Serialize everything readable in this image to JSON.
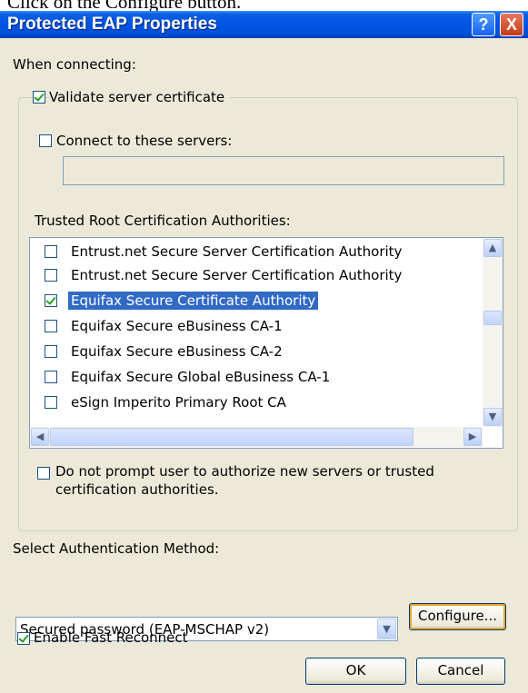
{
  "caption": "Click on the Configure button.",
  "window": {
    "title": "Protected EAP Properties",
    "help_glyph": "?",
    "close_glyph": "X"
  },
  "when_connecting": "When connecting:",
  "validate_cert": {
    "label": "Validate server certificate",
    "checked": true
  },
  "connect_servers": {
    "label": "Connect to these servers:",
    "checked": false,
    "value": ""
  },
  "trusted_roots": {
    "label": "Trusted Root Certification Authorities:",
    "items": [
      {
        "label": "Entrust.net Secure Server Certification Authority",
        "checked": false,
        "selected": false
      },
      {
        "label": "Entrust.net Secure Server Certification Authority",
        "checked": false,
        "selected": false
      },
      {
        "label": "Equifax Secure Certificate Authority",
        "checked": true,
        "selected": true
      },
      {
        "label": "Equifax Secure eBusiness CA-1",
        "checked": false,
        "selected": false
      },
      {
        "label": "Equifax Secure eBusiness CA-2",
        "checked": false,
        "selected": false
      },
      {
        "label": "Equifax Secure Global eBusiness CA-1",
        "checked": false,
        "selected": false
      },
      {
        "label": "eSign Imperito Primary Root CA",
        "checked": false,
        "selected": false
      }
    ]
  },
  "no_prompt": {
    "line1": "Do not prompt user to authorize new servers or trusted",
    "line2": "certification authorities.",
    "checked": false
  },
  "auth_method": {
    "label": "Select Authentication Method:",
    "value": "Secured password (EAP-MSCHAP v2)"
  },
  "configure_button": "Configure...",
  "fast_reconnect": {
    "label": "Enable Fast Reconnect",
    "checked": true
  },
  "ok_button": "OK",
  "cancel_button": "Cancel"
}
